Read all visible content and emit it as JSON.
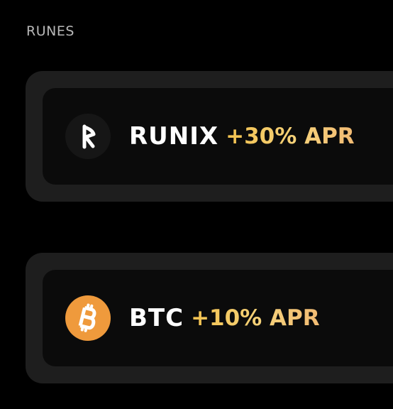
{
  "section": {
    "label": "RUNES"
  },
  "tokens": [
    {
      "name": "RUNIX",
      "apr": "+30% APR",
      "icon": "runix-rune-icon",
      "icon_bg": "#161616"
    },
    {
      "name": "BTC",
      "apr": "+10% APR",
      "icon": "bitcoin-icon",
      "icon_bg": "#ef9a3c"
    }
  ],
  "colors": {
    "background": "#000000",
    "card_outer": "#1e1e1e",
    "card_inner": "#0b0b0b",
    "apr_accent": "#f3c35f",
    "label_gray": "#b8b8b8"
  }
}
